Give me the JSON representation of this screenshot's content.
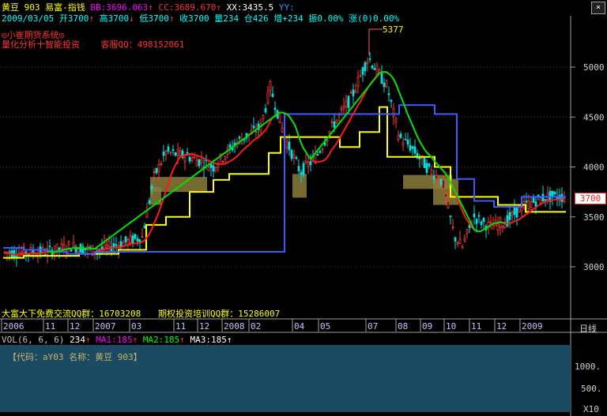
{
  "header": {
    "name": "黄豆",
    "code": "903",
    "indicator": "易富-指钱",
    "bb": "BB:3696.063",
    "cc": "CC:3689.670",
    "xx": "XX:3435.5",
    "yy": "YY:"
  },
  "quote_line": {
    "date": "2009/03/05",
    "open": "开3700",
    "high": "高3700",
    "low": "低3700",
    "close": "收3700",
    "volume": "量234",
    "position": "仓426",
    "increase": "增+234",
    "amplitude": "振0.00%",
    "change": "涨(0)0.00%"
  },
  "brand": {
    "line1": "◎小崔期货系统◎",
    "line2": "量化分析十智能投资",
    "service": "客服QQ：498152061"
  },
  "promo": {
    "qq_group": "大富大下免费交流QQ群：16703208",
    "training": "期权投资培训QQ群：15286007"
  },
  "annotations": {
    "peak_label": "5377",
    "last_price": "3700"
  },
  "y_axis": {
    "ticks": [
      "5000",
      "4500",
      "4000",
      "3500",
      "3000"
    ]
  },
  "x_axis": {
    "labels": [
      "2006",
      "11",
      "12",
      "2007",
      "03",
      "11",
      "12",
      "2008",
      "02",
      "04",
      "05",
      "07",
      "08",
      "09",
      "10",
      "11",
      "12",
      "2009"
    ]
  },
  "controls": {
    "close_label": "×",
    "day_label": "日线"
  },
  "volume_panel": {
    "params": "VOL(6, 6, 6)",
    "vol_value": "234",
    "ma1": "MA1:185",
    "ma2": "MA2:185",
    "ma3": "MA3:185",
    "code_info": "【代码：aY03  名称：黄豆  903】",
    "ticks": [
      "1000.",
      "500.",
      "X10"
    ]
  },
  "colors": {
    "background": "#000000",
    "up": "#ff3b3b",
    "down": "#00e0e0",
    "ma_red": "#ff1a1a",
    "ma_green": "#00e000",
    "line_yellow": "#ffff00",
    "line_blue": "#3b5bff",
    "box": "#8a7d3a",
    "volume_bg": "#1a4b63"
  }
}
